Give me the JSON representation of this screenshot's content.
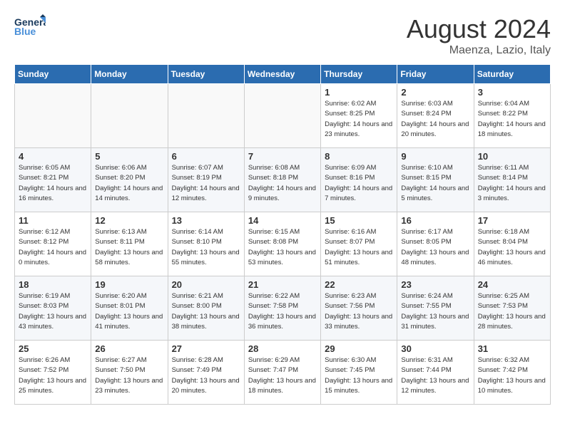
{
  "header": {
    "logo_general": "General",
    "logo_blue": "Blue",
    "month_year": "August 2024",
    "location": "Maenza, Lazio, Italy"
  },
  "weekdays": [
    "Sunday",
    "Monday",
    "Tuesday",
    "Wednesday",
    "Thursday",
    "Friday",
    "Saturday"
  ],
  "weeks": [
    [
      {
        "day": "",
        "info": ""
      },
      {
        "day": "",
        "info": ""
      },
      {
        "day": "",
        "info": ""
      },
      {
        "day": "",
        "info": ""
      },
      {
        "day": "1",
        "sunrise": "6:02 AM",
        "sunset": "8:25 PM",
        "daylight": "14 hours and 23 minutes."
      },
      {
        "day": "2",
        "sunrise": "6:03 AM",
        "sunset": "8:24 PM",
        "daylight": "14 hours and 20 minutes."
      },
      {
        "day": "3",
        "sunrise": "6:04 AM",
        "sunset": "8:22 PM",
        "daylight": "14 hours and 18 minutes."
      }
    ],
    [
      {
        "day": "4",
        "sunrise": "6:05 AM",
        "sunset": "8:21 PM",
        "daylight": "14 hours and 16 minutes."
      },
      {
        "day": "5",
        "sunrise": "6:06 AM",
        "sunset": "8:20 PM",
        "daylight": "14 hours and 14 minutes."
      },
      {
        "day": "6",
        "sunrise": "6:07 AM",
        "sunset": "8:19 PM",
        "daylight": "14 hours and 12 minutes."
      },
      {
        "day": "7",
        "sunrise": "6:08 AM",
        "sunset": "8:18 PM",
        "daylight": "14 hours and 9 minutes."
      },
      {
        "day": "8",
        "sunrise": "6:09 AM",
        "sunset": "8:16 PM",
        "daylight": "14 hours and 7 minutes."
      },
      {
        "day": "9",
        "sunrise": "6:10 AM",
        "sunset": "8:15 PM",
        "daylight": "14 hours and 5 minutes."
      },
      {
        "day": "10",
        "sunrise": "6:11 AM",
        "sunset": "8:14 PM",
        "daylight": "14 hours and 3 minutes."
      }
    ],
    [
      {
        "day": "11",
        "sunrise": "6:12 AM",
        "sunset": "8:12 PM",
        "daylight": "14 hours and 0 minutes."
      },
      {
        "day": "12",
        "sunrise": "6:13 AM",
        "sunset": "8:11 PM",
        "daylight": "13 hours and 58 minutes."
      },
      {
        "day": "13",
        "sunrise": "6:14 AM",
        "sunset": "8:10 PM",
        "daylight": "13 hours and 55 minutes."
      },
      {
        "day": "14",
        "sunrise": "6:15 AM",
        "sunset": "8:08 PM",
        "daylight": "13 hours and 53 minutes."
      },
      {
        "day": "15",
        "sunrise": "6:16 AM",
        "sunset": "8:07 PM",
        "daylight": "13 hours and 51 minutes."
      },
      {
        "day": "16",
        "sunrise": "6:17 AM",
        "sunset": "8:05 PM",
        "daylight": "13 hours and 48 minutes."
      },
      {
        "day": "17",
        "sunrise": "6:18 AM",
        "sunset": "8:04 PM",
        "daylight": "13 hours and 46 minutes."
      }
    ],
    [
      {
        "day": "18",
        "sunrise": "6:19 AM",
        "sunset": "8:03 PM",
        "daylight": "13 hours and 43 minutes."
      },
      {
        "day": "19",
        "sunrise": "6:20 AM",
        "sunset": "8:01 PM",
        "daylight": "13 hours and 41 minutes."
      },
      {
        "day": "20",
        "sunrise": "6:21 AM",
        "sunset": "8:00 PM",
        "daylight": "13 hours and 38 minutes."
      },
      {
        "day": "21",
        "sunrise": "6:22 AM",
        "sunset": "7:58 PM",
        "daylight": "13 hours and 36 minutes."
      },
      {
        "day": "22",
        "sunrise": "6:23 AM",
        "sunset": "7:56 PM",
        "daylight": "13 hours and 33 minutes."
      },
      {
        "day": "23",
        "sunrise": "6:24 AM",
        "sunset": "7:55 PM",
        "daylight": "13 hours and 31 minutes."
      },
      {
        "day": "24",
        "sunrise": "6:25 AM",
        "sunset": "7:53 PM",
        "daylight": "13 hours and 28 minutes."
      }
    ],
    [
      {
        "day": "25",
        "sunrise": "6:26 AM",
        "sunset": "7:52 PM",
        "daylight": "13 hours and 25 minutes."
      },
      {
        "day": "26",
        "sunrise": "6:27 AM",
        "sunset": "7:50 PM",
        "daylight": "13 hours and 23 minutes."
      },
      {
        "day": "27",
        "sunrise": "6:28 AM",
        "sunset": "7:49 PM",
        "daylight": "13 hours and 20 minutes."
      },
      {
        "day": "28",
        "sunrise": "6:29 AM",
        "sunset": "7:47 PM",
        "daylight": "13 hours and 18 minutes."
      },
      {
        "day": "29",
        "sunrise": "6:30 AM",
        "sunset": "7:45 PM",
        "daylight": "13 hours and 15 minutes."
      },
      {
        "day": "30",
        "sunrise": "6:31 AM",
        "sunset": "7:44 PM",
        "daylight": "13 hours and 12 minutes."
      },
      {
        "day": "31",
        "sunrise": "6:32 AM",
        "sunset": "7:42 PM",
        "daylight": "13 hours and 10 minutes."
      }
    ]
  ],
  "labels": {
    "sunrise": "Sunrise:",
    "sunset": "Sunset:",
    "daylight": "Daylight:"
  }
}
